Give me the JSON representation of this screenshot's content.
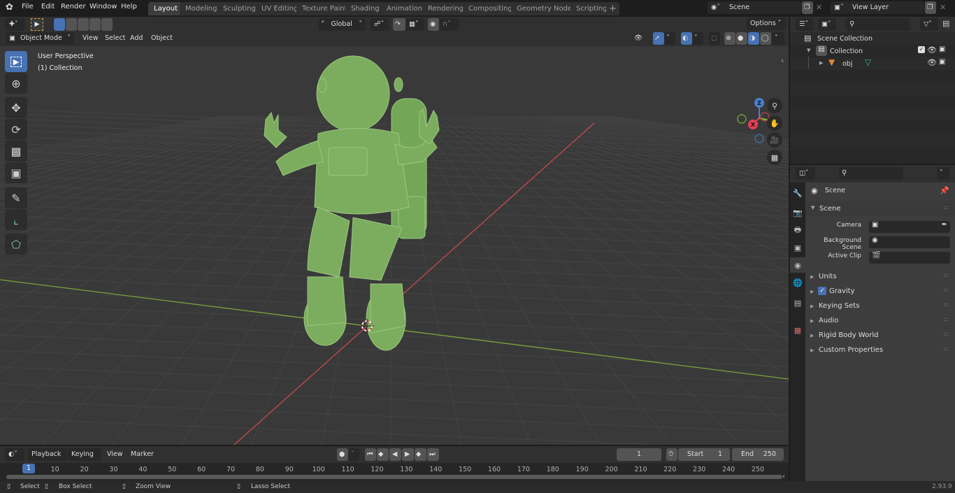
{
  "menu": {
    "items": [
      "File",
      "Edit",
      "Render",
      "Window",
      "Help"
    ]
  },
  "workspaces": [
    "Layout",
    "Modeling",
    "Sculpting",
    "UV Editing",
    "Texture Paint",
    "Shading",
    "Animation",
    "Rendering",
    "Compositing",
    "Geometry Nodes",
    "Scripting"
  ],
  "workspace_active": "Layout",
  "workspace_add": "+",
  "scene_selector": {
    "value": "Scene"
  },
  "view_layer_selector": {
    "value": "View Layer"
  },
  "viewport_header": {
    "mode": "Object Mode",
    "menus": [
      "View",
      "Select",
      "Add",
      "Object"
    ],
    "transform_orientation": "Global",
    "options_label": "Options"
  },
  "viewport": {
    "perspective_label": "User Perspective",
    "collection_label": "(1) Collection",
    "gizmo_axes": {
      "x": "X",
      "y": "Y",
      "z": "Z"
    },
    "object_color": "#7cad5e",
    "x_axis_color": "#c8484f",
    "y_axis_color": "#7fa33a"
  },
  "toolbar": {
    "tools": [
      "select-box",
      "cursor",
      "move",
      "rotate",
      "scale",
      "transform",
      "annotate",
      "measure",
      "add-cube"
    ]
  },
  "outliner": {
    "search_placeholder": "",
    "scene_collection": "Scene Collection",
    "collection": "Collection",
    "object": "obj"
  },
  "properties": {
    "search_placeholder": "",
    "context_title": "Scene",
    "panel_title": "Scene",
    "fields": [
      {
        "label": "Camera",
        "value": ""
      },
      {
        "label": "Background Scene",
        "value": ""
      },
      {
        "label": "Active Clip",
        "value": ""
      }
    ],
    "subpanels": [
      {
        "label": "Units",
        "checkbox": false
      },
      {
        "label": "Gravity",
        "checkbox": true
      },
      {
        "label": "Keying Sets",
        "checkbox": false
      },
      {
        "label": "Audio",
        "checkbox": false
      },
      {
        "label": "Rigid Body World",
        "checkbox": false
      },
      {
        "label": "Custom Properties",
        "checkbox": false
      }
    ]
  },
  "timeline": {
    "menus": [
      "Playback",
      "Keying",
      "View",
      "Marker"
    ],
    "current_frame": "1",
    "start_label": "Start",
    "start_value": "1",
    "end_label": "End",
    "end_value": "250",
    "playhead_frame": "1",
    "ticks": [
      "10",
      "20",
      "30",
      "40",
      "50",
      "60",
      "70",
      "80",
      "90",
      "100",
      "110",
      "120",
      "130",
      "140",
      "150",
      "160",
      "170",
      "180",
      "190",
      "200",
      "210",
      "220",
      "230",
      "240",
      "250"
    ]
  },
  "statusbar": {
    "select": "Select",
    "box_select": "Box Select",
    "zoom_view": "Zoom View",
    "lasso_select": "Lasso Select",
    "version": "2.93.9"
  }
}
